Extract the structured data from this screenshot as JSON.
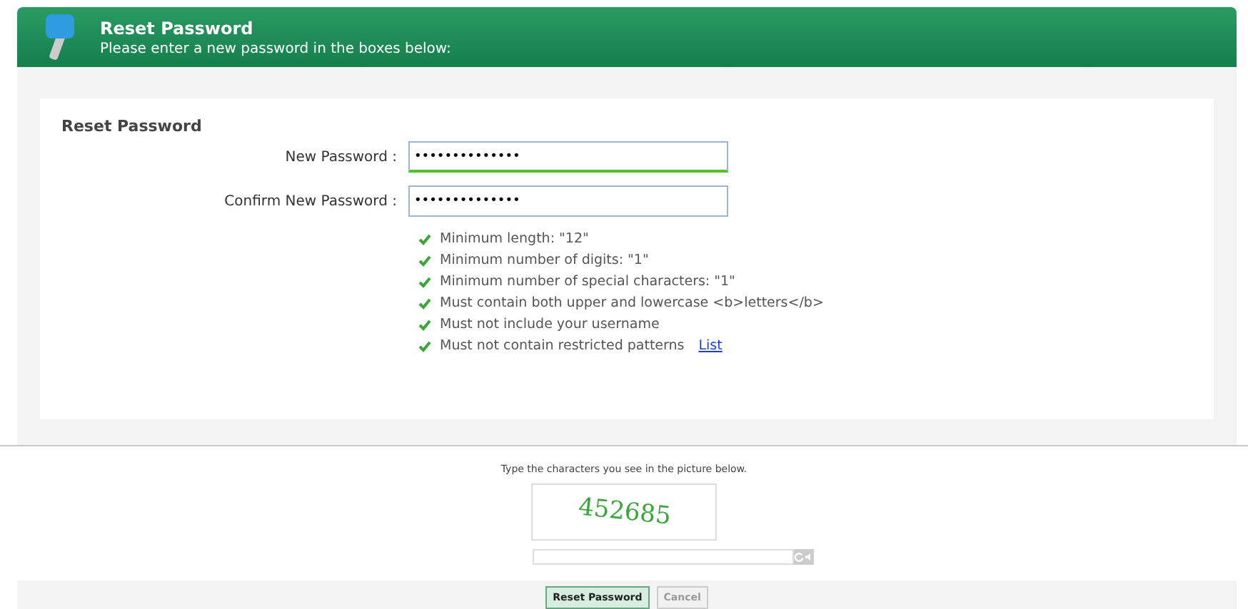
{
  "header": {
    "title": "Reset Password",
    "subtitle": "Please enter a new password in the boxes below:"
  },
  "form": {
    "title": "Reset Password",
    "fields": [
      {
        "label": "New Password :",
        "value": "••••••••••••••",
        "valid": true
      },
      {
        "label": "Confirm New Password :",
        "value": "••••••••••••••",
        "valid": false
      }
    ],
    "rules": [
      {
        "text": "Minimum length: \"12\"",
        "checked": true
      },
      {
        "text": "Minimum number of digits: \"1\"",
        "checked": true
      },
      {
        "text": "Minimum number of special characters: \"1\"",
        "checked": true
      },
      {
        "text": "Must contain both upper and lowercase <b>letters</b>",
        "checked": true
      },
      {
        "text": "Must not include your username",
        "checked": true
      },
      {
        "text": "Must not contain restricted patterns",
        "checked": true,
        "link": "List"
      }
    ]
  },
  "captcha": {
    "instruction": "Type the characters you see in the picture below.",
    "code": "452685"
  },
  "buttons": [
    {
      "label": "Reset Password",
      "primary": true
    },
    {
      "label": "Cancel",
      "primary": false
    }
  ]
}
